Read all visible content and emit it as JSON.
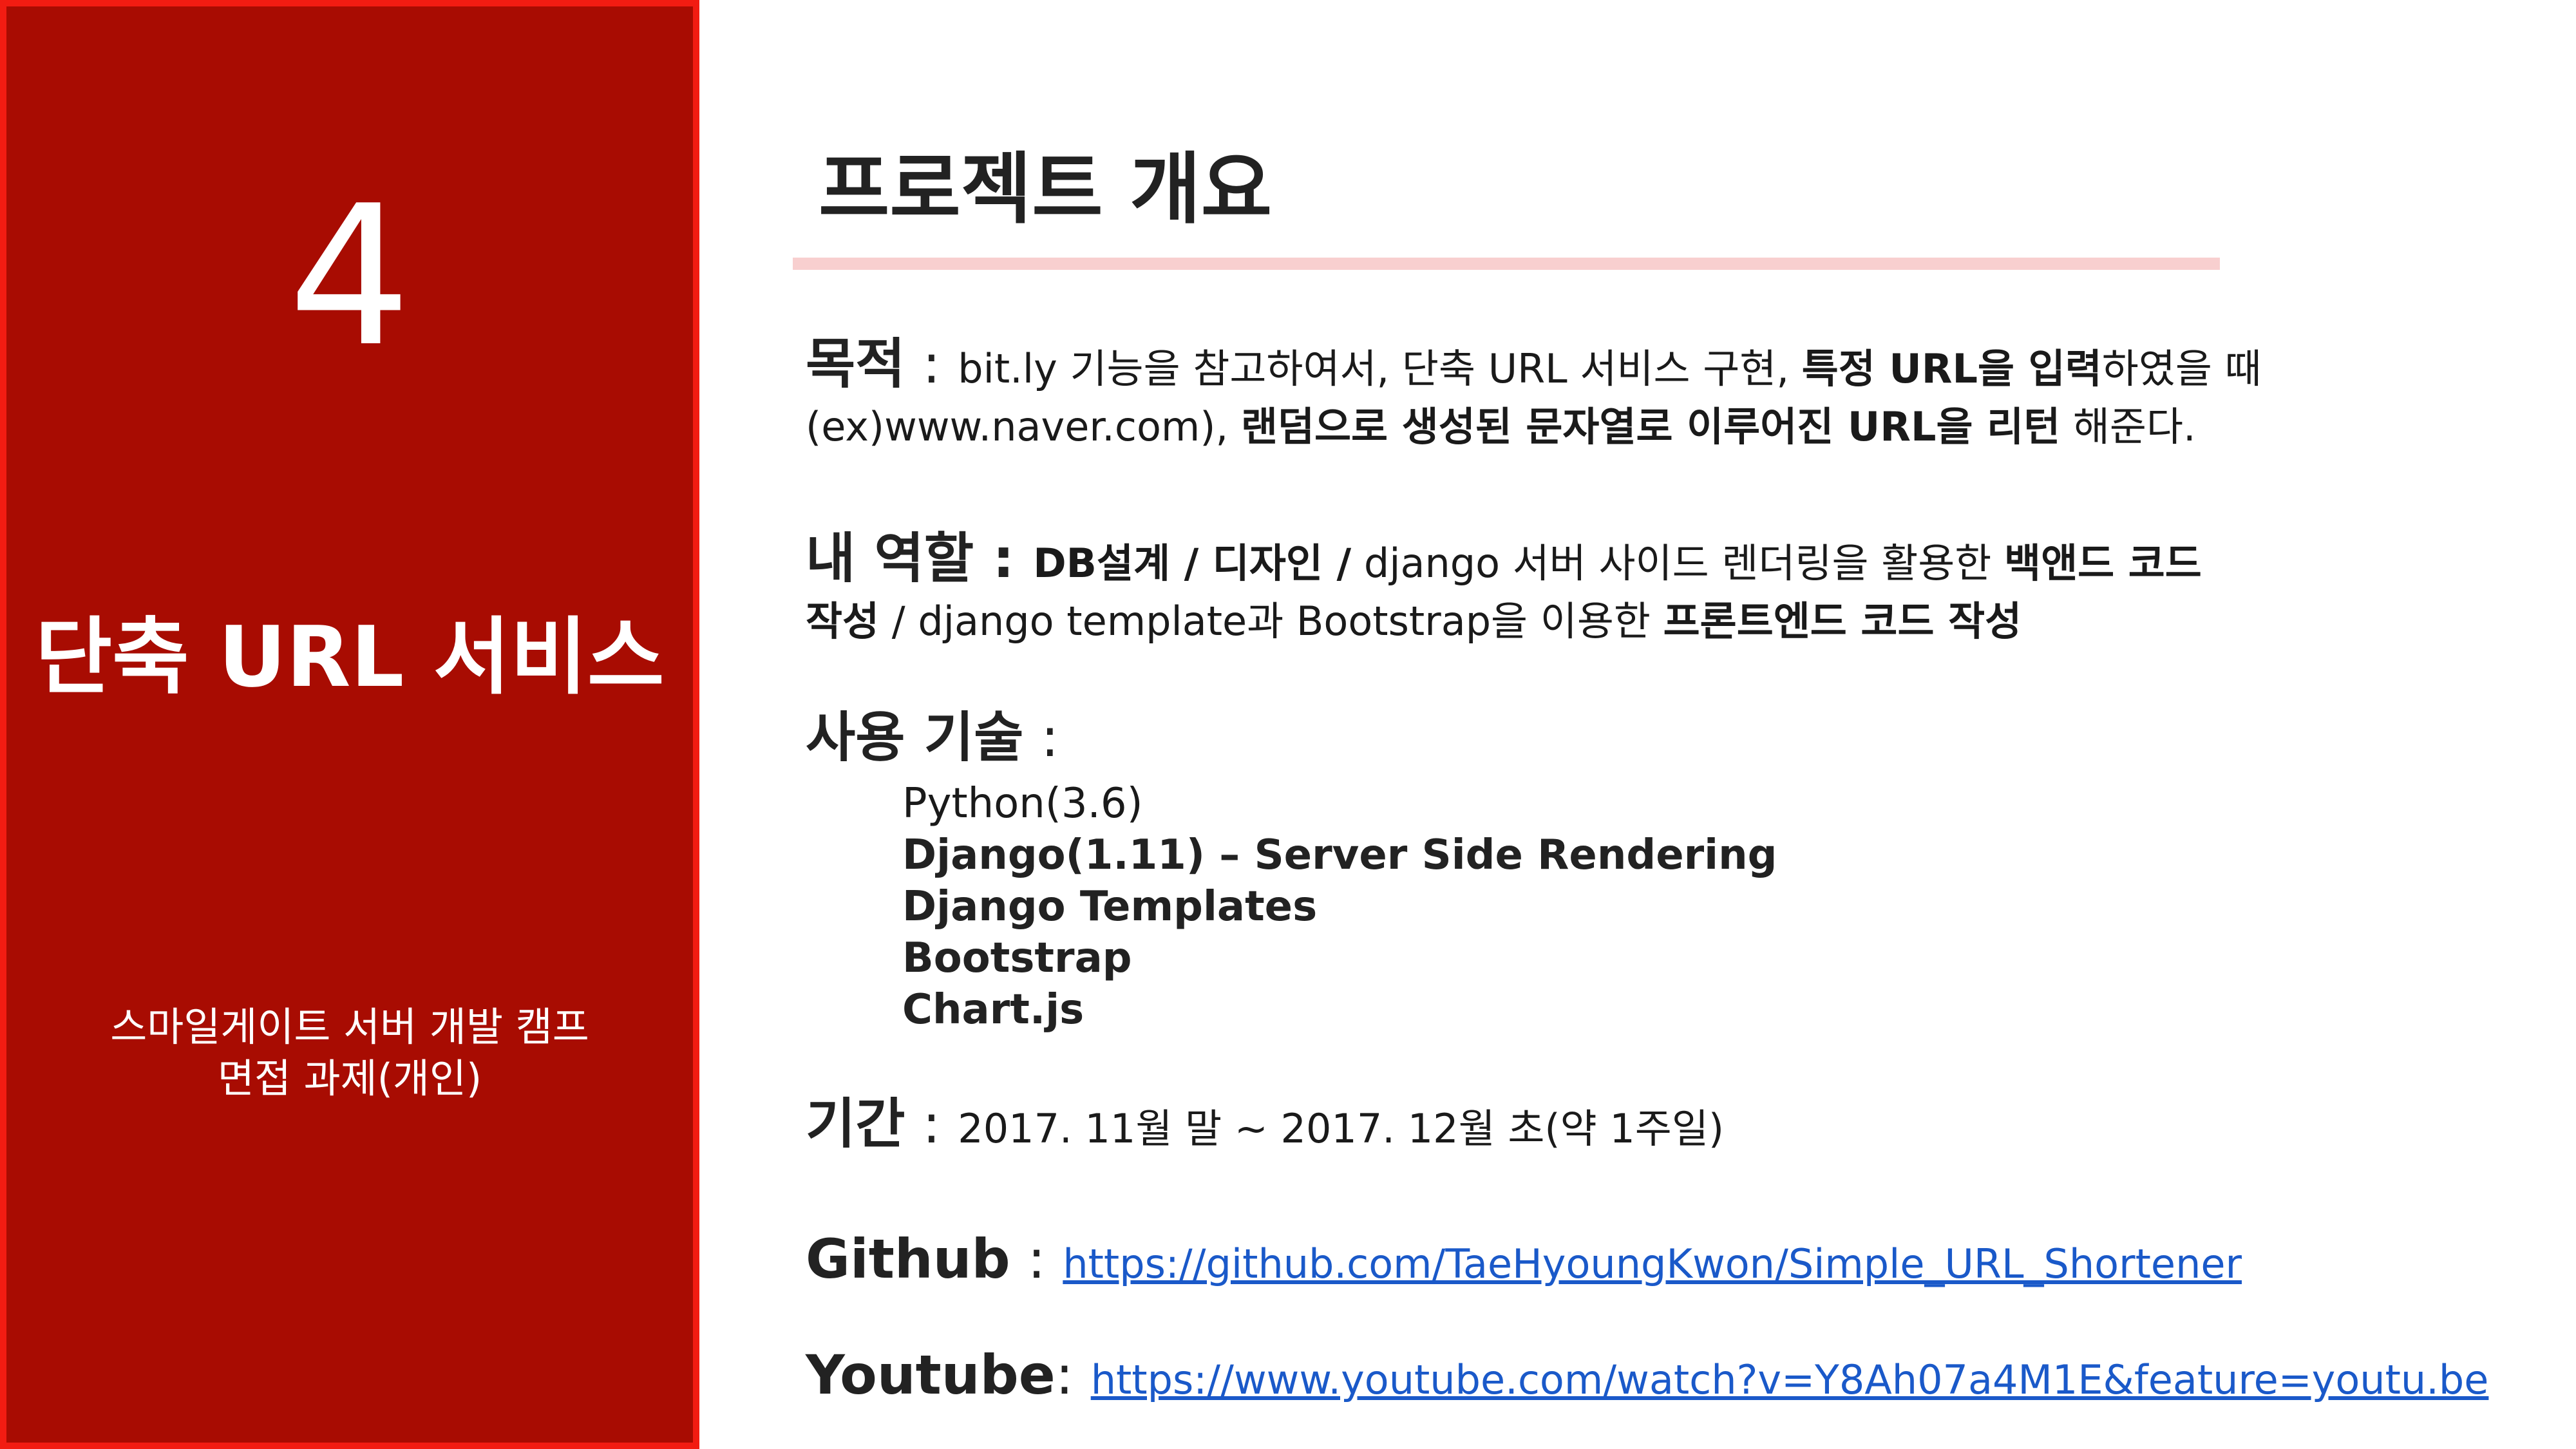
{
  "left_panel": {
    "number": "4",
    "title": "단축 URL 서비스",
    "context_line1": "스마일게이트 서버 개발 캠프",
    "context_line2": "면접 과제(개인)"
  },
  "section": {
    "title": "프로젝트 개요"
  },
  "goal": {
    "label": "목적",
    "colon": " : ",
    "l1_a": "bit.ly 기능을 참고하여서, 단축 URL 서비스 구현, ",
    "l1_b": "특정 URL을 입력",
    "l1_c": "하였을 때",
    "l2_a": "(ex)www.naver.com), ",
    "l2_b": "랜덤으로 생성된 문자열로 이루어진 URL을 리턴",
    "l2_c": " 해준다."
  },
  "role": {
    "label": "내 역할",
    "colon": " : ",
    "l1_a": "DB설계 / 디자인 /",
    "l1_b": " django 서버 사이드 렌더링을 활용한 ",
    "l1_c": "백앤드 코드",
    "l2_a": "작성",
    "l2_b": " / django template과 Bootstrap을 이용한 ",
    "l2_c": "프론트엔드 코드 작성"
  },
  "stack": {
    "label": "사용 기술",
    "colon": " :",
    "items": [
      "Python(3.6)",
      "Django(1.11) – Server Side Rendering",
      "Django Templates",
      "Bootstrap",
      "Chart.js"
    ]
  },
  "period": {
    "label": "기간",
    "colon": " : ",
    "text": "2017. 11월 말 ~ 2017. 12월 초(약 1주일)"
  },
  "github": {
    "label": "Github",
    "colon": " : ",
    "url": "https://github.com/TaeHyoungKwon/Simple_URL_Shortener"
  },
  "youtube": {
    "label": "Youtube",
    "colon": ": ",
    "url": "https://www.youtube.com/watch?v=Y8Ah07a4M1E&feature=youtu.be"
  },
  "colors": {
    "panel": "#a80c02",
    "panel_border": "#f21c12",
    "underline": "#f8cfcf",
    "link": "#1a59c9"
  }
}
